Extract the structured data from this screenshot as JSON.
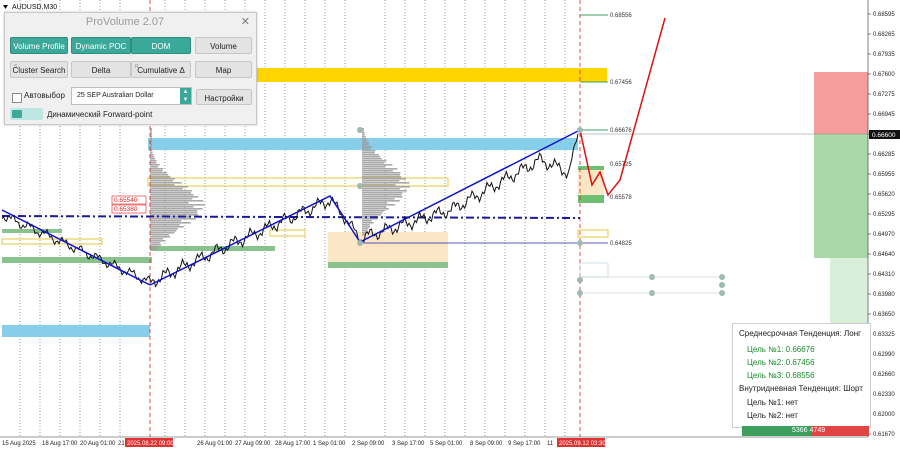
{
  "symbol": "AUDUSD,M30",
  "price_axis": {
    "labels": [
      "0.68595",
      "0.68265",
      "0.67935",
      "0.67600",
      "0.67275",
      "0.66945",
      "0.66600",
      "0.66285",
      "0.65955",
      "0.65620",
      "0.65295",
      "0.64970",
      "0.64640",
      "0.64310",
      "0.63980",
      "0.63650",
      "0.63325",
      "0.62990",
      "0.62660",
      "0.62330",
      "0.62000",
      "0.61670"
    ],
    "current_price": "0.66600"
  },
  "time_axis": {
    "labels": [
      "15 Aug 2025",
      "18 Aug 17:00",
      "20 Aug 01:00",
      "21",
      "26 Aug 01:00",
      "27 Aug 09:00",
      "28 Aug 17:00",
      "1 Sep 01:00",
      "2 Sep 09:00",
      "3 Sep 17:00",
      "5 Sep 01:00",
      "8 Sep 09:00",
      "9 Sep 17:00",
      "11"
    ],
    "highlight_1": "2025.08.22 09:00",
    "highlight_2": "2025.09.12 03:30"
  },
  "levels": {
    "target1": "0.66676",
    "target2": "0.67456",
    "target3": "0.68556",
    "level_mid": "0.65725",
    "level_low": "0.65578",
    "level_base": "0.64825",
    "tag_a": "0.65540",
    "tag_b": "0.65380"
  },
  "panel": {
    "title": "ProVolume 2.07",
    "close": "✕",
    "buttons": [
      {
        "label": "Volume Profile",
        "tag": "V",
        "active": true
      },
      {
        "label": "Dynamic POC",
        "tag": "P",
        "active": true
      },
      {
        "label": "DOM",
        "tag": "D",
        "active": true
      },
      {
        "label": "Volume",
        "tag": "",
        "active": false
      },
      {
        "label": "Cluster Search",
        "tag": "S",
        "active": false
      },
      {
        "label": "Delta",
        "tag": "",
        "active": false
      },
      {
        "label": "Cumulative Δ",
        "tag": "R",
        "active": false
      },
      {
        "label": "Map",
        "tag": "",
        "active": false
      }
    ],
    "auto_label": "Автовыбор",
    "asset": "25 SEP Australian Dollar",
    "settings": "Настройки",
    "forward_label": "Динамический Forward-point"
  },
  "trend": {
    "medium_title": "Среднесрочная Тенденция: Лонг",
    "medium_targets": [
      {
        "label": "Цель №1:",
        "value": "0.66676"
      },
      {
        "label": "Цель №2:",
        "value": "0.67456"
      },
      {
        "label": "Цель №3:",
        "value": "0.68556"
      }
    ],
    "intraday_title": "Внутридневная Тенденция: Шорт",
    "intraday_targets": [
      {
        "label": "Цель №1:",
        "value": "нет"
      },
      {
        "label": "Цель №2:",
        "value": "нет"
      }
    ]
  },
  "volume_strip": {
    "buy": "5366",
    "sell": "4749"
  },
  "colors": {
    "blue_zone": "#87ceeb",
    "yellow_zone": "#ffd400",
    "green_zone": "#6fbf73",
    "trend_line": "#0000cc",
    "forecast": "#dd1111",
    "accent": "#3aa99a"
  }
}
